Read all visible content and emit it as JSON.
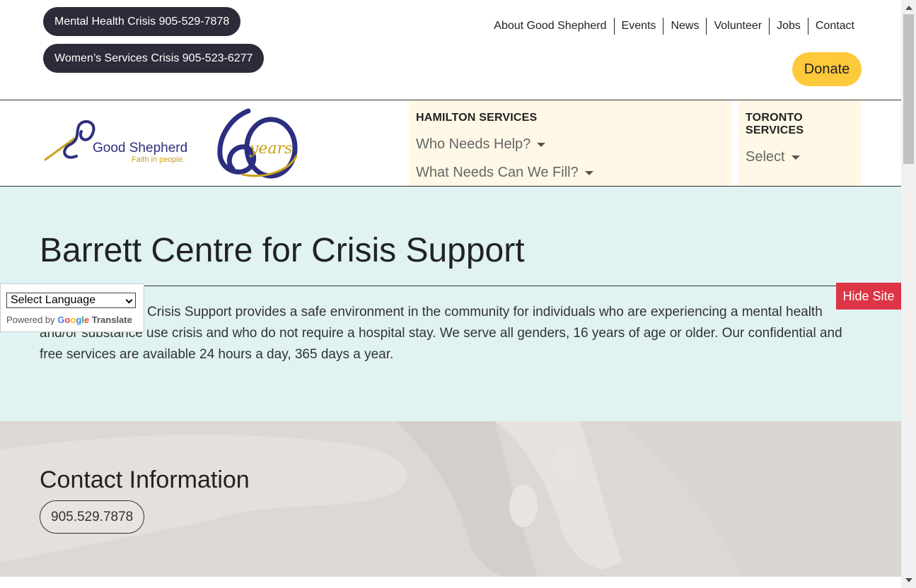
{
  "crisis": {
    "mental_health": "Mental Health Crisis 905-529-7878",
    "womens_services": "Women’s Services Crisis 905-523-6277"
  },
  "utility_nav": [
    "About Good Shepherd",
    "Events",
    "News",
    "Volunteer",
    "Jobs",
    "Contact"
  ],
  "donate_label": "Donate",
  "logo": {
    "brand": "Good Shepherd",
    "tagline": "Faith in people.",
    "anniversary_text": "years"
  },
  "services": {
    "hamilton": {
      "title": "HAMILTON SERVICES",
      "dropdowns": [
        "Who Needs Help?",
        "What Needs Can We Fill?"
      ]
    },
    "toronto": {
      "title": "TORONTO SERVICES",
      "dropdowns": [
        "Select"
      ]
    }
  },
  "hero": {
    "title": "Barrett Centre for Crisis Support",
    "description": "Barrett Centre for Crisis Support provides a safe environment in the community for individuals who are experiencing a mental health and/or substance use crisis and who do not require a hospital stay. We serve all genders, 16 years of age or older. Our confidential and free services are available 24 hours a day, 365 days a year."
  },
  "contact": {
    "heading": "Contact Information",
    "phone": "905.529.7878"
  },
  "translate": {
    "select_label": "Select Language",
    "powered_by": "Powered by",
    "google": "Google",
    "translate": "Translate"
  },
  "hide_site_label": "Hide Site",
  "colors": {
    "crisis_button": "#2c2b3a",
    "donate": "#ffc93c",
    "hide_site": "#dc3545",
    "hero_bg": "#e0f3f2",
    "services_bg": "#fff8e6",
    "brand_navy": "#2c2f7f",
    "brand_gold": "#c8a21a"
  }
}
